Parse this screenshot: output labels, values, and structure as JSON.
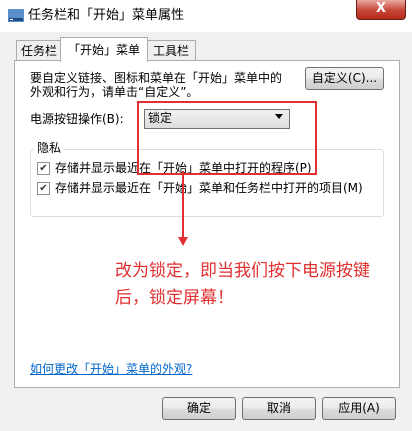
{
  "window": {
    "title": "任务栏和「开始」菜单属性",
    "close_label": "X"
  },
  "tabs": [
    {
      "label": "任务栏",
      "active": false
    },
    {
      "label": "「开始」菜单",
      "active": true
    },
    {
      "label": "工具栏",
      "active": false
    }
  ],
  "customize": {
    "description_line1": "要自定义链接、图标和菜单在「开始」菜单中的",
    "description_line2": "外观和行为，请单击“自定义”。",
    "button_label": "自定义(C)..."
  },
  "power_button": {
    "label": "电源按钮操作(B):",
    "selected_value": "锁定"
  },
  "privacy": {
    "group_title": "隐私",
    "items": [
      {
        "label": "存储并显示最近在「开始」菜单中打开的程序(P)",
        "checked": true,
        "mark": "✔"
      },
      {
        "label": "存储并显示最近在「开始」菜单和任务栏中打开的项目(M)",
        "checked": true,
        "mark": "✔"
      }
    ]
  },
  "annotation": {
    "line1": "改为锁定，即当我们按下电源按键",
    "line2": "后，锁定屏幕！",
    "color": "#e03030"
  },
  "help_link": "如何更改「开始」菜单的外观?",
  "footer": {
    "ok_label": "确定",
    "cancel_label": "取消",
    "apply_label": "应用(A)"
  }
}
